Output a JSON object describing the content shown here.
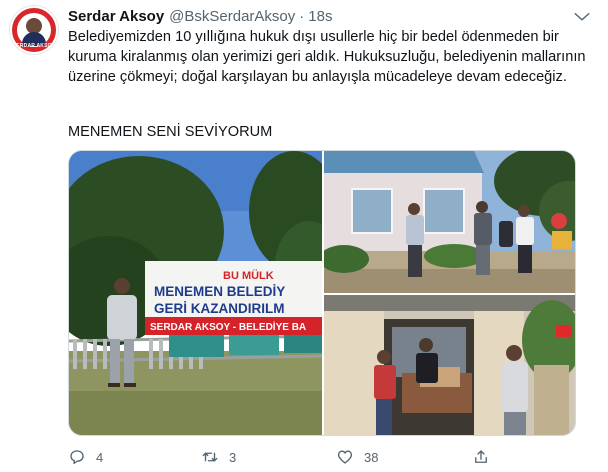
{
  "tweet": {
    "author_name": "Serdar Aksoy",
    "handle": "@BskSerdarAksoy",
    "separator": "·",
    "time": "18s",
    "body": "Belediyemizden 10 yıllığına hukuk dışı usullerle hiç bir bedel ödenmeden bir kuruma kiralanmış olan yerimizi geri aldık. Hukuksuzluğu, belediyenin mallarının üzerine çökmeyi; doğal karşılayan bu anlayışla mücadeleye devam edeceğiz.",
    "slogan": "MENEMEN SENİ SEVİYORUM",
    "avatar_text": "SERDAR AKSOY",
    "banner": {
      "line1": "BU MÜLK",
      "line2": "MENEMEN BELEDİY",
      "line3": "GERİ KAZANDIRILM",
      "line4": "SERDAR AKSOY - BELEDİYE BA"
    },
    "counts": {
      "replies": "4",
      "retweets": "3",
      "likes": "38"
    }
  },
  "icons": {
    "more": "more-icon",
    "reply": "reply-icon",
    "retweet": "retweet-icon",
    "like": "heart-icon",
    "share": "share-icon"
  },
  "colors": {
    "text": "#0f1419",
    "secondary": "#536471",
    "border": "#cfd9de",
    "avatar_red": "#d8262b"
  }
}
